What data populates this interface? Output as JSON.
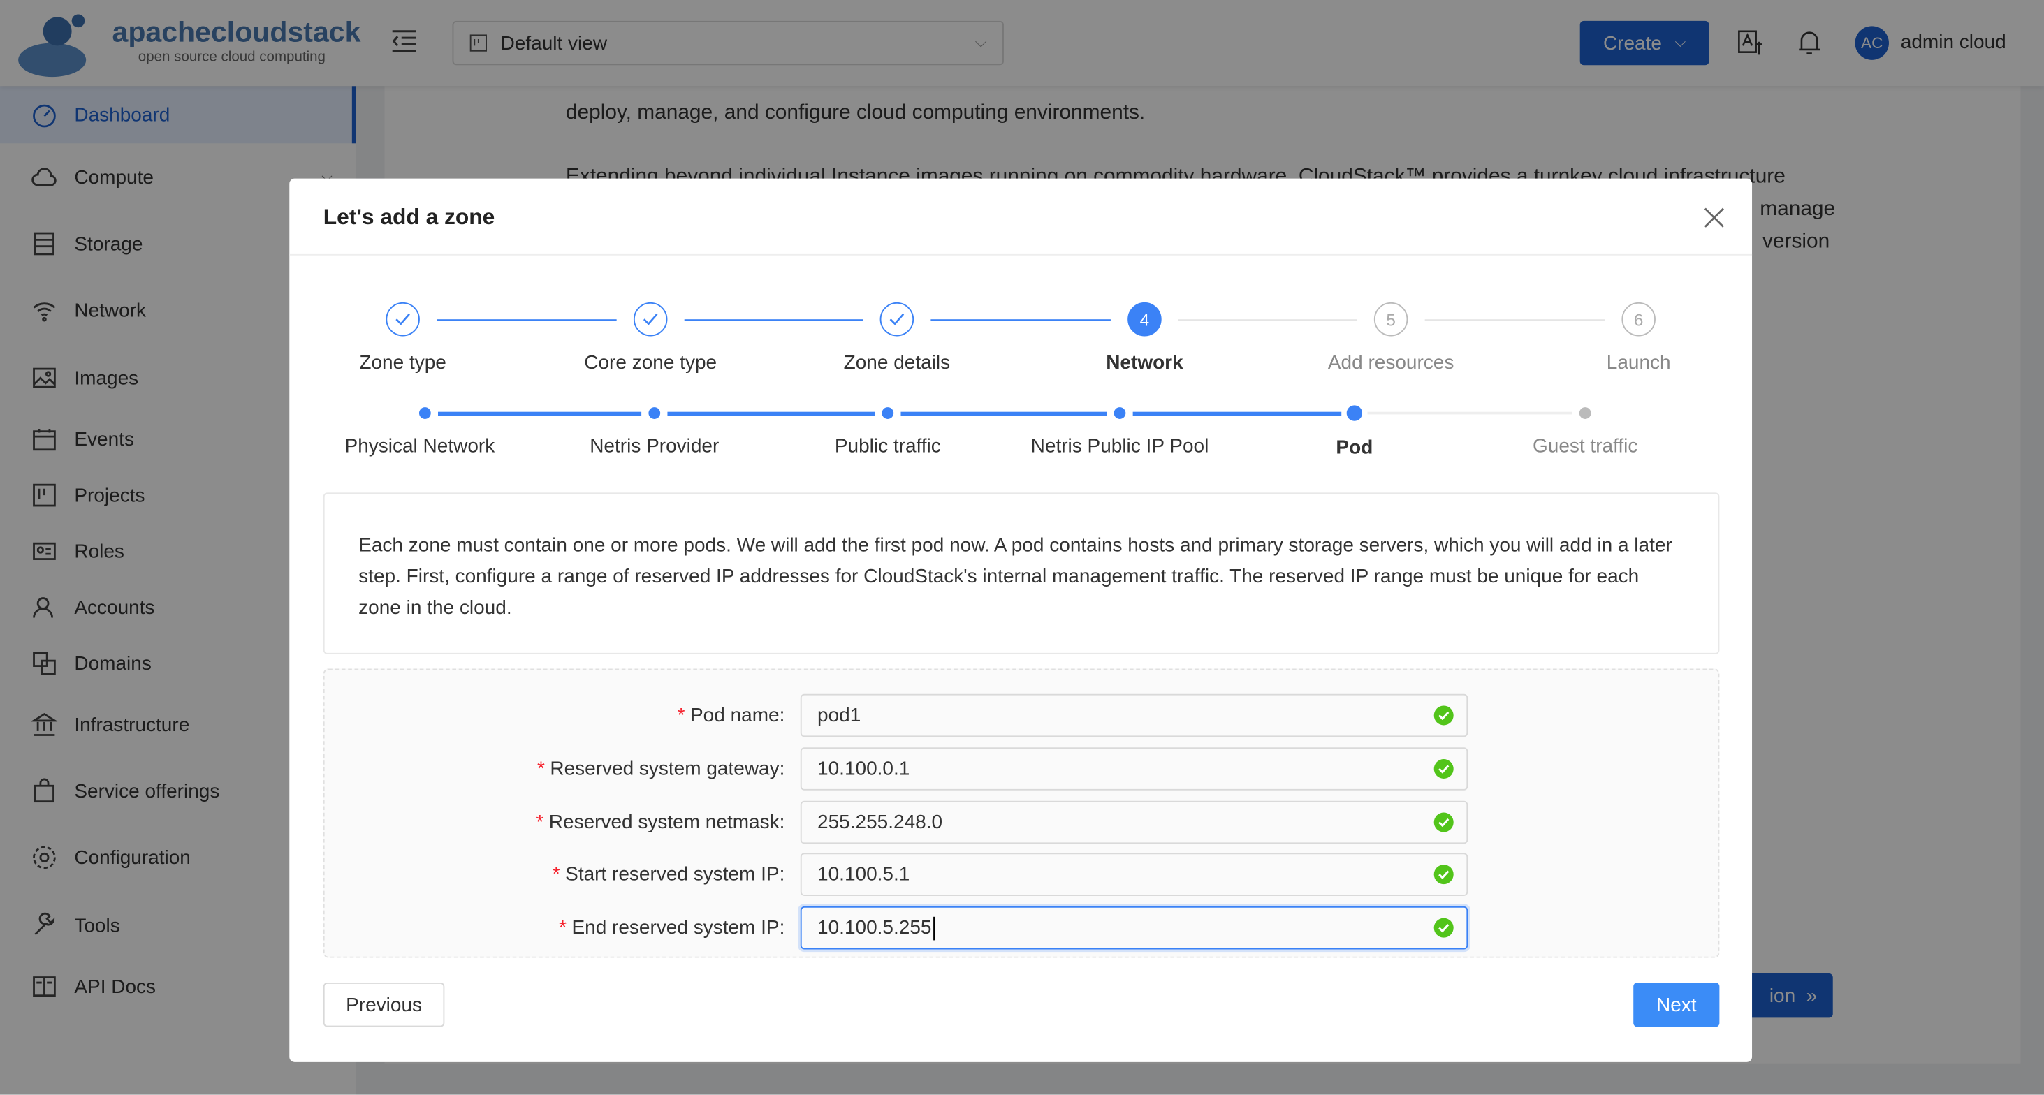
{
  "header": {
    "logo_text": "apachecloudstack",
    "logo_tagline": "open source cloud computing",
    "view_select": "Default view",
    "create_label": "Create",
    "avatar_initials": "AC",
    "user_name": "admin cloud"
  },
  "sidebar": {
    "items": [
      {
        "label": "Dashboard",
        "icon": "dashboard-icon",
        "active": true
      },
      {
        "label": "Compute",
        "icon": "cloud-icon"
      },
      {
        "label": "Storage",
        "icon": "database-icon"
      },
      {
        "label": "Network",
        "icon": "wifi-icon"
      },
      {
        "label": "Images",
        "icon": "picture-icon"
      },
      {
        "label": "Events",
        "icon": "schedule-icon"
      },
      {
        "label": "Projects",
        "icon": "project-icon"
      },
      {
        "label": "Roles",
        "icon": "idcard-icon"
      },
      {
        "label": "Accounts",
        "icon": "team-icon"
      },
      {
        "label": "Domains",
        "icon": "block-icon"
      },
      {
        "label": "Infrastructure",
        "icon": "bank-icon"
      },
      {
        "label": "Service offerings",
        "icon": "shopping-icon"
      },
      {
        "label": "Configuration",
        "icon": "setting-icon"
      },
      {
        "label": "Tools",
        "icon": "tool-icon"
      },
      {
        "label": "API Docs",
        "icon": "read-icon"
      }
    ]
  },
  "background": {
    "lines": [
      "deploy, manage, and configure cloud computing environments.",
      "Extending beyond individual Instance images running on commodity hardware, CloudStack™ provides a turnkey cloud infrastructure",
      "manage",
      "version"
    ],
    "button_fragment": "ion"
  },
  "modal": {
    "title": "Let's add a zone",
    "steps": [
      {
        "label": "Zone type",
        "status": "done"
      },
      {
        "label": "Core zone type",
        "status": "done"
      },
      {
        "label": "Zone details",
        "status": "done"
      },
      {
        "label": "Network",
        "status": "current",
        "number": "4"
      },
      {
        "label": "Add resources",
        "status": "todo",
        "number": "5"
      },
      {
        "label": "Launch",
        "status": "todo",
        "number": "6"
      }
    ],
    "substeps": [
      {
        "label": "Physical Network",
        "status": "done"
      },
      {
        "label": "Netris Provider",
        "status": "done"
      },
      {
        "label": "Public traffic",
        "status": "done"
      },
      {
        "label": "Netris Public IP Pool",
        "status": "done"
      },
      {
        "label": "Pod",
        "status": "current"
      },
      {
        "label": "Guest traffic",
        "status": "todo"
      }
    ],
    "info": "Each zone must contain one or more pods. We will add the first pod now. A pod contains hosts and primary storage servers, which you will add in a later step. First, configure a range of reserved IP addresses for CloudStack's internal management traffic. The reserved IP range must be unique for each zone in the cloud.",
    "fields": [
      {
        "label": "Pod name",
        "value": "pod1"
      },
      {
        "label": "Reserved system gateway",
        "value": "10.100.0.1"
      },
      {
        "label": "Reserved system netmask",
        "value": "255.255.248.0"
      },
      {
        "label": "Start reserved system IP",
        "value": "10.100.5.1"
      },
      {
        "label": "End reserved system IP",
        "value": "10.100.5.255",
        "focused": true
      }
    ],
    "previous_label": "Previous",
    "next_label": "Next"
  },
  "colors": {
    "primary": "#1e62d0",
    "step_blue": "#3b82f6",
    "success": "#52c41a",
    "required": "#f5222d"
  }
}
